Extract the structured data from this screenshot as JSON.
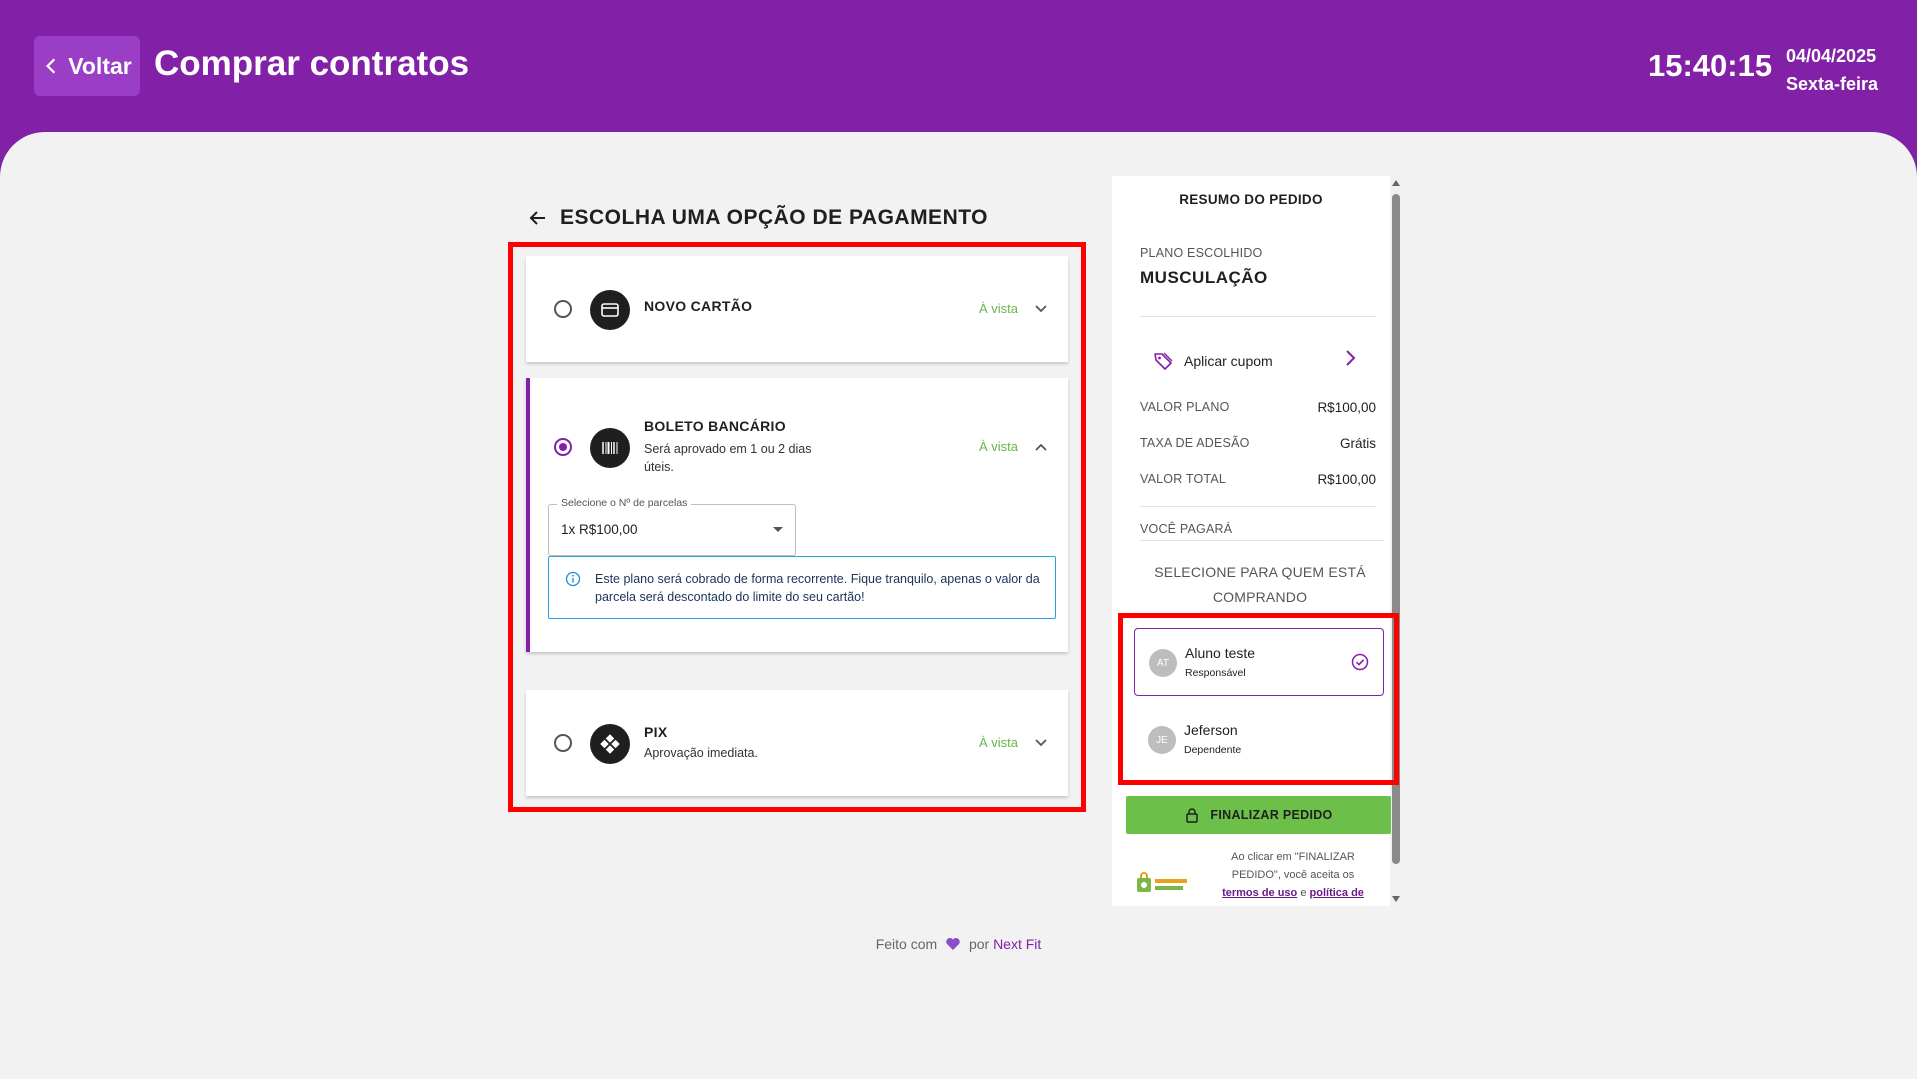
{
  "header": {
    "back_label": "Voltar",
    "title": "Comprar contratos",
    "time": "15:40:15",
    "date": "04/04/2025",
    "weekday": "Sexta-feira",
    "bg_color": "#8221a8"
  },
  "payment": {
    "section_title": "ESCOLHA UMA OPÇÃO DE PAGAMENTO",
    "options": [
      {
        "name": "NOVO CARTÃO",
        "desc": "",
        "tag": "À vista",
        "selected": false,
        "icon": "credit-card-icon"
      },
      {
        "name": "BOLETO BANCÁRIO",
        "desc": "Será aprovado em 1 ou 2 dias úteis.",
        "tag": "À vista",
        "selected": true,
        "icon": "barcode-icon"
      },
      {
        "name": "PIX",
        "desc": "Aprovação imediata.",
        "tag": "À vista",
        "selected": false,
        "icon": "pix-icon"
      }
    ],
    "installments_label": "Selecione o Nº de parcelas",
    "installments_value": "1x R$100,00",
    "info_text": "Este plano será cobrado de forma recorrente. Fique tranquilo, apenas o valor da parcela será descontado do limite do seu cartão!"
  },
  "summary": {
    "title": "RESUMO DO PEDIDO",
    "plan_label": "PLANO ESCOLHIDO",
    "plan_name": "MUSCULAÇÃO",
    "coupon_label": "Aplicar cupom",
    "rows": [
      {
        "label": "VALOR PLANO",
        "value": "R$100,00"
      },
      {
        "label": "TAXA DE ADESÃO",
        "value": "Grátis"
      },
      {
        "label": "VALOR TOTAL",
        "value": "R$100,00"
      }
    ],
    "you_pay_label": "VOCÊ PAGARÁ",
    "buy_for_label": "SELECIONE PARA QUEM ESTÁ COMPRANDO",
    "people": [
      {
        "initials": "AT",
        "name": "Aluno teste",
        "role": "Responsável",
        "selected": true
      },
      {
        "initials": "JE",
        "name": "Jeferson",
        "role": "Dependente",
        "selected": false
      }
    ],
    "finish_label": "FINALIZAR PEDIDO",
    "terms_prefix": "Ao clicar em \"FINALIZAR PEDIDO\", você aceita os",
    "terms_link": "termos de uso",
    "terms_and": "e",
    "privacy_link": "política de",
    "accent_color": "#8221a8",
    "finish_color": "#6cc04a"
  },
  "footer": {
    "made_with": "Feito com",
    "by": "por",
    "brand": "Next Fit"
  }
}
